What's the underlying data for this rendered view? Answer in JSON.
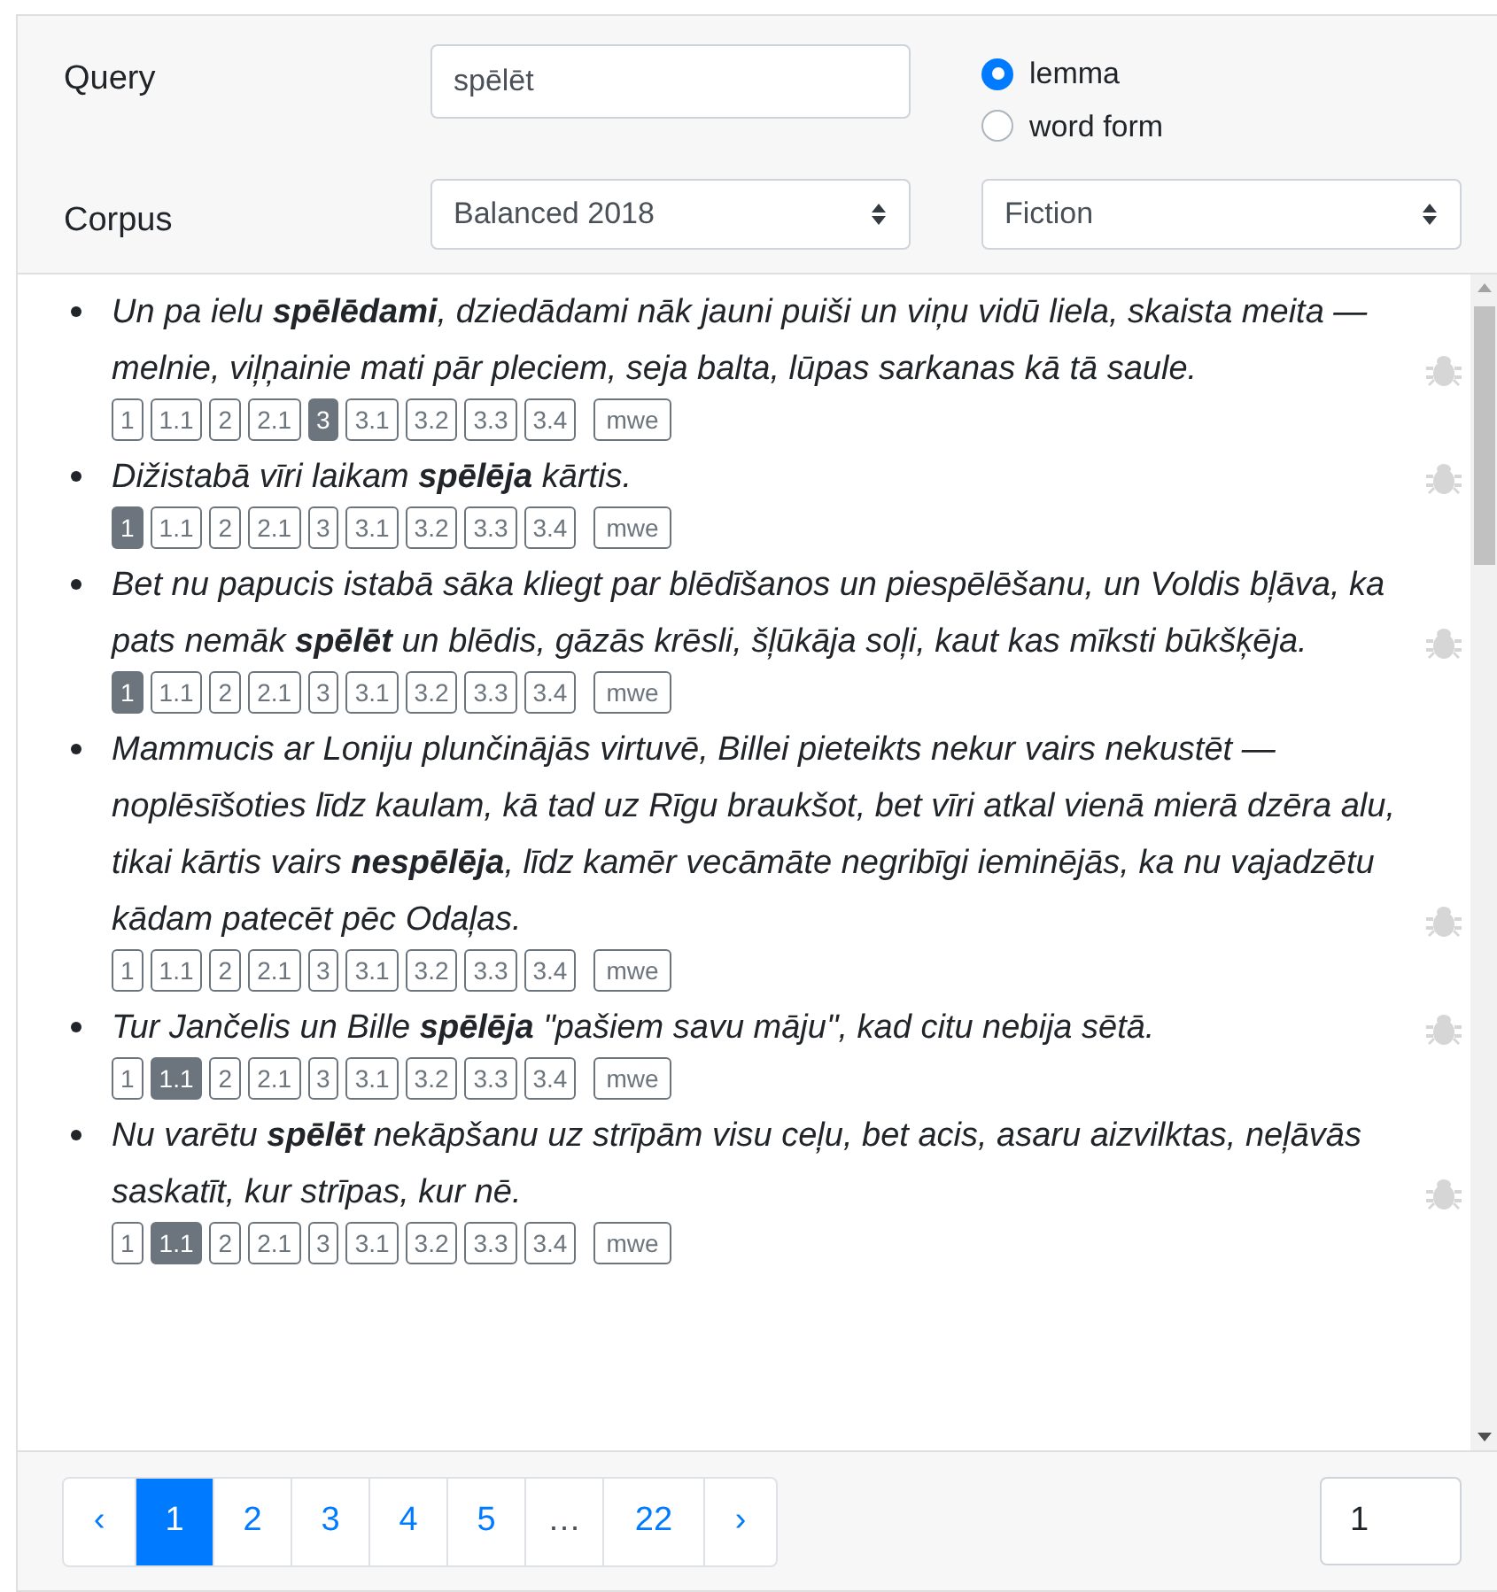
{
  "form": {
    "query_label": "Query",
    "query_value": "spēlēt",
    "search_modes": [
      {
        "label": "lemma",
        "selected": true
      },
      {
        "label": "word form",
        "selected": false
      }
    ],
    "corpus_label": "Corpus",
    "corpus_value": "Balanced 2018",
    "genre_value": "Fiction"
  },
  "results": [
    {
      "text": "Un pa ielu **spēlēdami**, dziedādami nāk jauni puiši un viņu vidū liela, skaista meita — melnie, viļņainie mati pār pleciem, seja balta, lūpas sarkanas kā tā saule.",
      "senses": [
        {
          "label": "1",
          "selected": false
        },
        {
          "label": "1.1",
          "selected": false
        },
        {
          "label": "2",
          "selected": false
        },
        {
          "label": "2.1",
          "selected": false
        },
        {
          "label": "3",
          "selected": true
        },
        {
          "label": "3.1",
          "selected": false
        },
        {
          "label": "3.2",
          "selected": false
        },
        {
          "label": "3.3",
          "selected": false
        },
        {
          "label": "3.4",
          "selected": false
        },
        {
          "label": "mwe",
          "selected": false
        }
      ]
    },
    {
      "text": "Dižistabā vīri laikam **spēlēja** kārtis.",
      "senses": [
        {
          "label": "1",
          "selected": true
        },
        {
          "label": "1.1",
          "selected": false
        },
        {
          "label": "2",
          "selected": false
        },
        {
          "label": "2.1",
          "selected": false
        },
        {
          "label": "3",
          "selected": false
        },
        {
          "label": "3.1",
          "selected": false
        },
        {
          "label": "3.2",
          "selected": false
        },
        {
          "label": "3.3",
          "selected": false
        },
        {
          "label": "3.4",
          "selected": false
        },
        {
          "label": "mwe",
          "selected": false
        }
      ]
    },
    {
      "text": "Bet nu papucis istabā sāka kliegt par blēdīšanos un piespēlēšanu, un Voldis bļāva, ka pats nemāk **spēlēt** un blēdis, gāzās krēsli, šļūkāja soļi, kaut kas mīksti būkšķēja.",
      "senses": [
        {
          "label": "1",
          "selected": true
        },
        {
          "label": "1.1",
          "selected": false
        },
        {
          "label": "2",
          "selected": false
        },
        {
          "label": "2.1",
          "selected": false
        },
        {
          "label": "3",
          "selected": false
        },
        {
          "label": "3.1",
          "selected": false
        },
        {
          "label": "3.2",
          "selected": false
        },
        {
          "label": "3.3",
          "selected": false
        },
        {
          "label": "3.4",
          "selected": false
        },
        {
          "label": "mwe",
          "selected": false
        }
      ]
    },
    {
      "text": "Mammucis ar Loniju plunčinājās virtuvē, Billei pieteikts nekur vairs nekustēt — noplēsīšoties līdz kaulam, kā tad uz Rīgu braukšot, bet vīri atkal vienā mierā dzēra alu, tikai kārtis vairs **nespēlēja**, līdz kamēr vecāmāte negribīgi ieminējās, ka nu vajadzētu kādam patecēt pēc Odaļas.",
      "senses": [
        {
          "label": "1",
          "selected": false
        },
        {
          "label": "1.1",
          "selected": false
        },
        {
          "label": "2",
          "selected": false
        },
        {
          "label": "2.1",
          "selected": false
        },
        {
          "label": "3",
          "selected": false
        },
        {
          "label": "3.1",
          "selected": false
        },
        {
          "label": "3.2",
          "selected": false
        },
        {
          "label": "3.3",
          "selected": false
        },
        {
          "label": "3.4",
          "selected": false
        },
        {
          "label": "mwe",
          "selected": false
        }
      ]
    },
    {
      "text": "Tur Jančelis un Bille **spēlēja** \"pašiem savu māju\", kad citu nebija sētā.",
      "senses": [
        {
          "label": "1",
          "selected": false
        },
        {
          "label": "1.1",
          "selected": true
        },
        {
          "label": "2",
          "selected": false
        },
        {
          "label": "2.1",
          "selected": false
        },
        {
          "label": "3",
          "selected": false
        },
        {
          "label": "3.1",
          "selected": false
        },
        {
          "label": "3.2",
          "selected": false
        },
        {
          "label": "3.3",
          "selected": false
        },
        {
          "label": "3.4",
          "selected": false
        },
        {
          "label": "mwe",
          "selected": false
        }
      ]
    },
    {
      "text": "Nu varētu **spēlēt** nekāpšanu uz strīpām visu ceļu, bet acis, asaru aizvilktas, neļāvās saskatīt, kur strīpas, kur nē.",
      "senses": [
        {
          "label": "1",
          "selected": false
        },
        {
          "label": "1.1",
          "selected": true
        },
        {
          "label": "2",
          "selected": false
        },
        {
          "label": "2.1",
          "selected": false
        },
        {
          "label": "3",
          "selected": false
        },
        {
          "label": "3.1",
          "selected": false
        },
        {
          "label": "3.2",
          "selected": false
        },
        {
          "label": "3.3",
          "selected": false
        },
        {
          "label": "3.4",
          "selected": false
        },
        {
          "label": "mwe",
          "selected": false
        }
      ]
    }
  ],
  "pagination": [
    {
      "label": "‹",
      "kind": "arrow",
      "selected": false
    },
    {
      "label": "1",
      "kind": "page",
      "selected": true
    },
    {
      "label": "2",
      "kind": "page",
      "selected": false
    },
    {
      "label": "3",
      "kind": "page",
      "selected": false
    },
    {
      "label": "4",
      "kind": "page",
      "selected": false
    },
    {
      "label": "5",
      "kind": "page",
      "selected": false
    },
    {
      "label": "…",
      "kind": "gap",
      "selected": false
    },
    {
      "label": "22",
      "kind": "page",
      "selected": false
    },
    {
      "label": "›",
      "kind": "arrow",
      "selected": false
    }
  ],
  "page_input": "1"
}
